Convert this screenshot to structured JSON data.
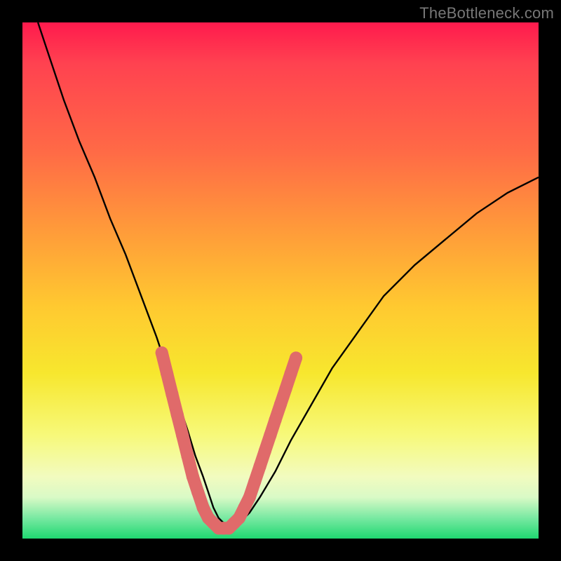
{
  "watermark": "TheBottleneck.com",
  "colors": {
    "background": "#000000",
    "gradient_stops": [
      "#ff1a4d",
      "#ff4250",
      "#ff6a46",
      "#ff9a3a",
      "#ffc930",
      "#f7e72e",
      "#f7f97a",
      "#f2fbbf",
      "#d9fac6",
      "#79e9a2",
      "#1fd871"
    ],
    "curve": "#000000",
    "marker": "#e06a6a"
  },
  "chart_data": {
    "type": "line",
    "title": "",
    "xlabel": "",
    "ylabel": "",
    "xlim": [
      0,
      100
    ],
    "ylim": [
      0,
      100
    ],
    "grid": false,
    "legend": false,
    "series": [
      {
        "name": "bottleneck-curve",
        "x": [
          3,
          5,
          8,
          11,
          14,
          17,
          20,
          23,
          26,
          28,
          30,
          32,
          33.5,
          35,
          36,
          37,
          38,
          39,
          40,
          41,
          42,
          44,
          46,
          49,
          52,
          56,
          60,
          65,
          70,
          76,
          82,
          88,
          94,
          100
        ],
        "y": [
          100,
          94,
          85,
          77,
          70,
          62,
          55,
          47,
          39,
          33,
          27,
          21,
          16,
          12,
          9,
          6,
          4,
          3,
          2,
          2,
          3,
          5,
          8,
          13,
          19,
          26,
          33,
          40,
          47,
          53,
          58,
          63,
          67,
          70
        ]
      }
    ],
    "markers": {
      "name": "highlighted-band",
      "x": [
        27,
        28,
        29,
        30,
        31,
        32,
        33,
        34,
        35,
        36,
        37,
        38,
        39,
        40,
        41,
        42,
        43,
        44,
        45,
        46,
        47,
        48,
        49,
        50,
        51,
        52,
        53
      ],
      "y": [
        36,
        32,
        28,
        24,
        20,
        16,
        12,
        9,
        6,
        4,
        3,
        2,
        2,
        2,
        3,
        4,
        6,
        8,
        11,
        14,
        17,
        20,
        23,
        26,
        29,
        32,
        35
      ]
    }
  }
}
